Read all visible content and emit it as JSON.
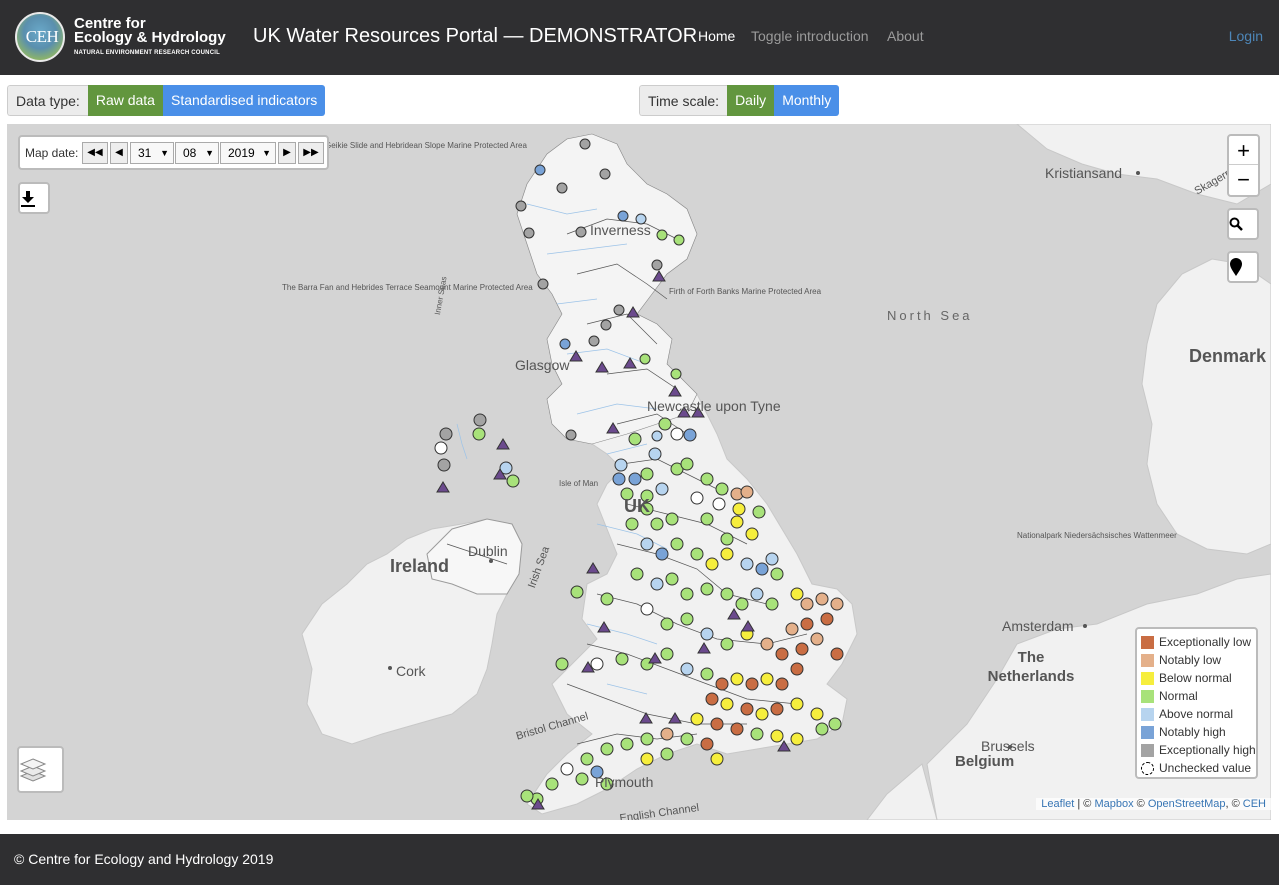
{
  "header": {
    "logo_line1": "Centre for",
    "logo_line2": "Ecology & Hydrology",
    "logo_line3": "NATURAL ENVIRONMENT RESEARCH COUNCIL",
    "logo_mark": "CEH",
    "title": "UK Water Resources Portal — DEMONSTRATOR",
    "nav": [
      "Home",
      "Toggle introduction",
      "About"
    ],
    "login": "Login"
  },
  "controls": {
    "data_type_label": "Data type:",
    "data_type_options": [
      "Raw data",
      "Standardised indicators"
    ],
    "data_type_selected": "Raw data",
    "time_scale_label": "Time scale:",
    "time_scale_options": [
      "Daily",
      "Monthly"
    ],
    "time_scale_selected": "Daily"
  },
  "map_date": {
    "label": "Map date:",
    "day": "31",
    "month": "08",
    "year": "2019",
    "buttons": [
      "first-icon",
      "prev-icon",
      "next-icon",
      "last-icon"
    ]
  },
  "map_labels": {
    "geikie": "Geikie Slide and Hebridean Slope Marine Protected Area",
    "barra": "The Barra Fan and Hebrides Terrace Seamount Marine Protected Area",
    "forth": "Firth of Forth Banks Marine Protected Area",
    "inner_seas": "Inner Seas",
    "inverness": "Inverness",
    "glasgow": "Glasgow",
    "newcastle": "Newcastle upon Tyne",
    "isle_of_man": "Isle of Man",
    "uk": "UK",
    "irish_sea": "Irish Sea",
    "dublin": "Dublin",
    "ireland": "Ireland",
    "cork": "Cork",
    "bristol": "Bristol Channel",
    "plymouth": "Plymouth",
    "english_channel": "English Channel",
    "north_sea": "North Sea",
    "kristiansand": "Kristiansand",
    "skagerrak": "Skagerr",
    "denmark": "Denmark",
    "wattenmeer": "Nationalpark Niedersächsisches Wattenmeer",
    "amsterdam": "Amsterdam",
    "netherlands": "The Netherlands",
    "brussels": "Brussels",
    "belgium": "Belgium"
  },
  "legend": [
    {
      "label": "Exceptionally low",
      "color": "#c96d43"
    },
    {
      "label": "Notably low",
      "color": "#e4b08a"
    },
    {
      "label": "Below normal",
      "color": "#f6ee3d"
    },
    {
      "label": "Normal",
      "color": "#a8e27a"
    },
    {
      "label": "Above normal",
      "color": "#b7d4ef"
    },
    {
      "label": "Notably high",
      "color": "#79a3d7"
    },
    {
      "label": "Exceptionally high",
      "color": "#a3a3a3"
    },
    {
      "label": "Unchecked value",
      "color": "#ffffff"
    }
  ],
  "icons": {
    "download": "download-icon",
    "search": "search-icon",
    "marker": "location-marker-icon",
    "layers": "layers-icon",
    "zoom_in": "+",
    "zoom_out": "−"
  },
  "attribution": {
    "leaflet": "Leaflet",
    "sep1": " | © ",
    "mapbox": "Mapbox",
    "sep2": " © ",
    "osm": "OpenStreetMap",
    "sep3": ", © ",
    "ceh": "CEH"
  },
  "footer": "© Centre for Ecology and Hydrology 2019"
}
